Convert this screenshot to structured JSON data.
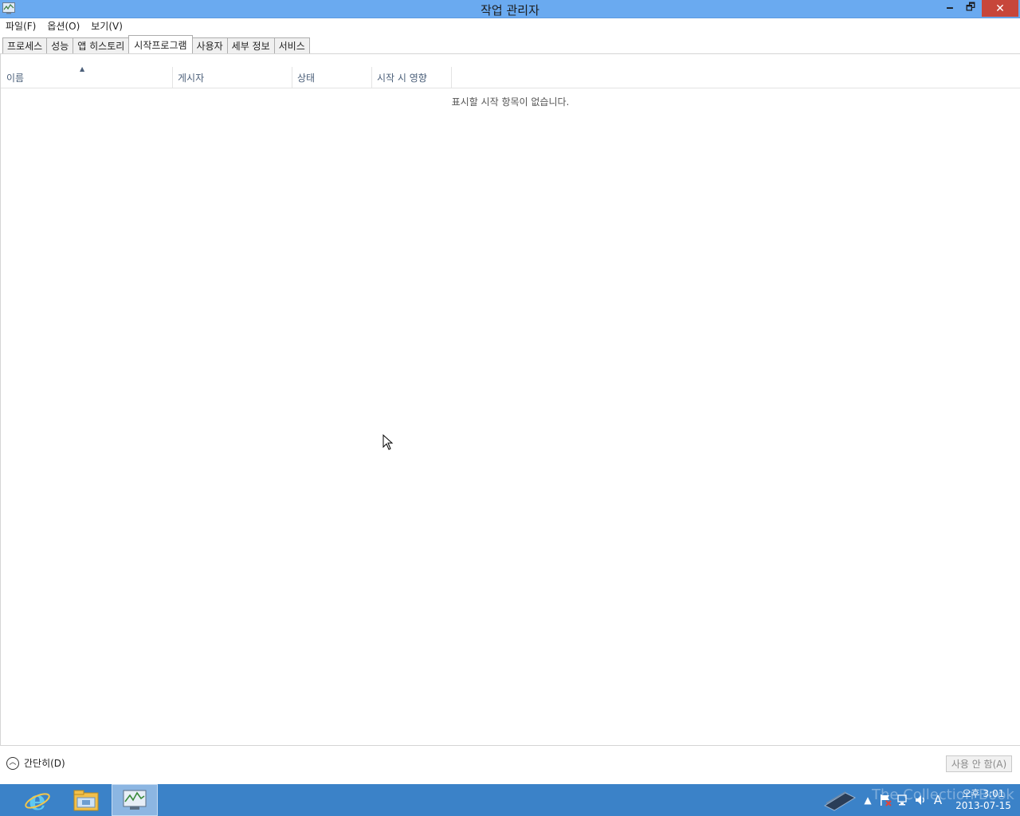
{
  "window": {
    "title": "작업 관리자",
    "controls": {
      "minimize": "🗕",
      "maximize": "🗗",
      "close": "✕"
    }
  },
  "menu": {
    "file": "파일(F)",
    "options": "옵션(O)",
    "view": "보기(V)"
  },
  "tabs": {
    "processes": "프로세스",
    "performance": "성능",
    "app_history": "앱 히스토리",
    "startup": "시작프로그램",
    "users": "사용자",
    "details": "세부 정보",
    "services": "서비스",
    "active": "startup"
  },
  "startup_table": {
    "columns": {
      "name": "이름",
      "publisher": "게시자",
      "status": "상태",
      "startup_impact": "시작 시 영향"
    },
    "sort_column": "name",
    "sort_direction": "ascending",
    "empty_message": "표시할 시작 항목이 없습니다."
  },
  "footer": {
    "fewer_details": "간단히(D)",
    "disable_button": "사용 안 함(A)"
  },
  "taskbar": {
    "apps": [
      "internet-explorer-icon",
      "file-explorer-icon",
      "task-manager-icon"
    ],
    "active_app": "task-manager-icon",
    "tray": {
      "ime_indicator": "A",
      "time": "오후 3:01",
      "date": "2013-07-15"
    },
    "watermark": "The Collection Book"
  },
  "colors": {
    "titlebar": "#6aaaf0",
    "close_button": "#c7463a",
    "taskbar": "#3b82c8",
    "column_header_text": "#4c607a"
  }
}
